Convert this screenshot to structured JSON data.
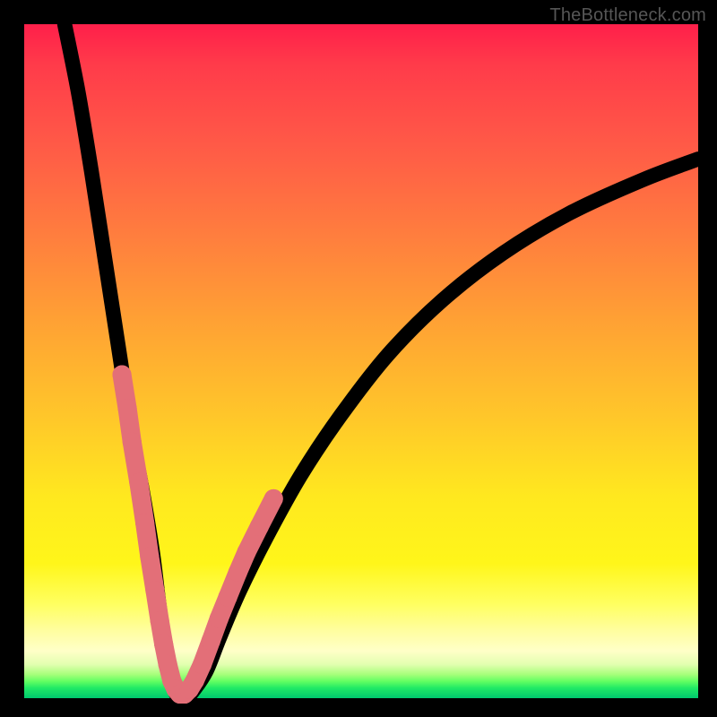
{
  "watermark": "TheBottleneck.com",
  "chart_data": {
    "type": "line",
    "title": "",
    "xlabel": "",
    "ylabel": "",
    "xlim": [
      0,
      100
    ],
    "ylim": [
      0,
      100
    ],
    "grid": false,
    "legend": false,
    "series": [
      {
        "name": "curve",
        "x": [
          6,
          8,
          10,
          12,
          14,
          16,
          17.5,
          19,
          20,
          21,
          22,
          23,
          24,
          25,
          27,
          29,
          32,
          36,
          41,
          47,
          54,
          62,
          71,
          81,
          92,
          100
        ],
        "y": [
          100,
          90,
          78,
          65,
          52,
          39,
          31,
          22,
          14,
          7,
          2,
          0,
          0,
          1,
          4,
          9,
          16,
          24,
          33,
          42,
          51,
          59,
          66,
          72,
          77,
          80
        ]
      }
    ],
    "markers": {
      "radius": 1.4,
      "points_xy": [
        [
          14.5,
          48
        ],
        [
          15.3,
          43
        ],
        [
          16.0,
          38
        ],
        [
          17.0,
          32
        ],
        [
          17.9,
          26
        ],
        [
          18.6,
          21
        ],
        [
          19.4,
          16
        ],
        [
          20.1,
          11.5
        ],
        [
          20.7,
          8
        ],
        [
          21.3,
          5
        ],
        [
          21.9,
          2.6
        ],
        [
          22.5,
          1.3
        ],
        [
          23.1,
          0.6
        ],
        [
          23.8,
          0.6
        ],
        [
          24.5,
          1.3
        ],
        [
          25.3,
          2.6
        ],
        [
          26.4,
          5
        ],
        [
          27.7,
          8.5
        ],
        [
          28.9,
          11.8
        ],
        [
          30.2,
          15
        ],
        [
          31.7,
          18.7
        ],
        [
          33.0,
          21.7
        ],
        [
          34.9,
          25.5
        ],
        [
          37.0,
          29.6
        ]
      ]
    },
    "background_gradient_stops": [
      {
        "pos": 0.0,
        "color": "#ff1f4a"
      },
      {
        "pos": 0.3,
        "color": "#ff7a3f"
      },
      {
        "pos": 0.6,
        "color": "#ffd024"
      },
      {
        "pos": 0.85,
        "color": "#ffff70"
      },
      {
        "pos": 0.95,
        "color": "#c8ff90"
      },
      {
        "pos": 1.0,
        "color": "#00c96e"
      }
    ]
  }
}
